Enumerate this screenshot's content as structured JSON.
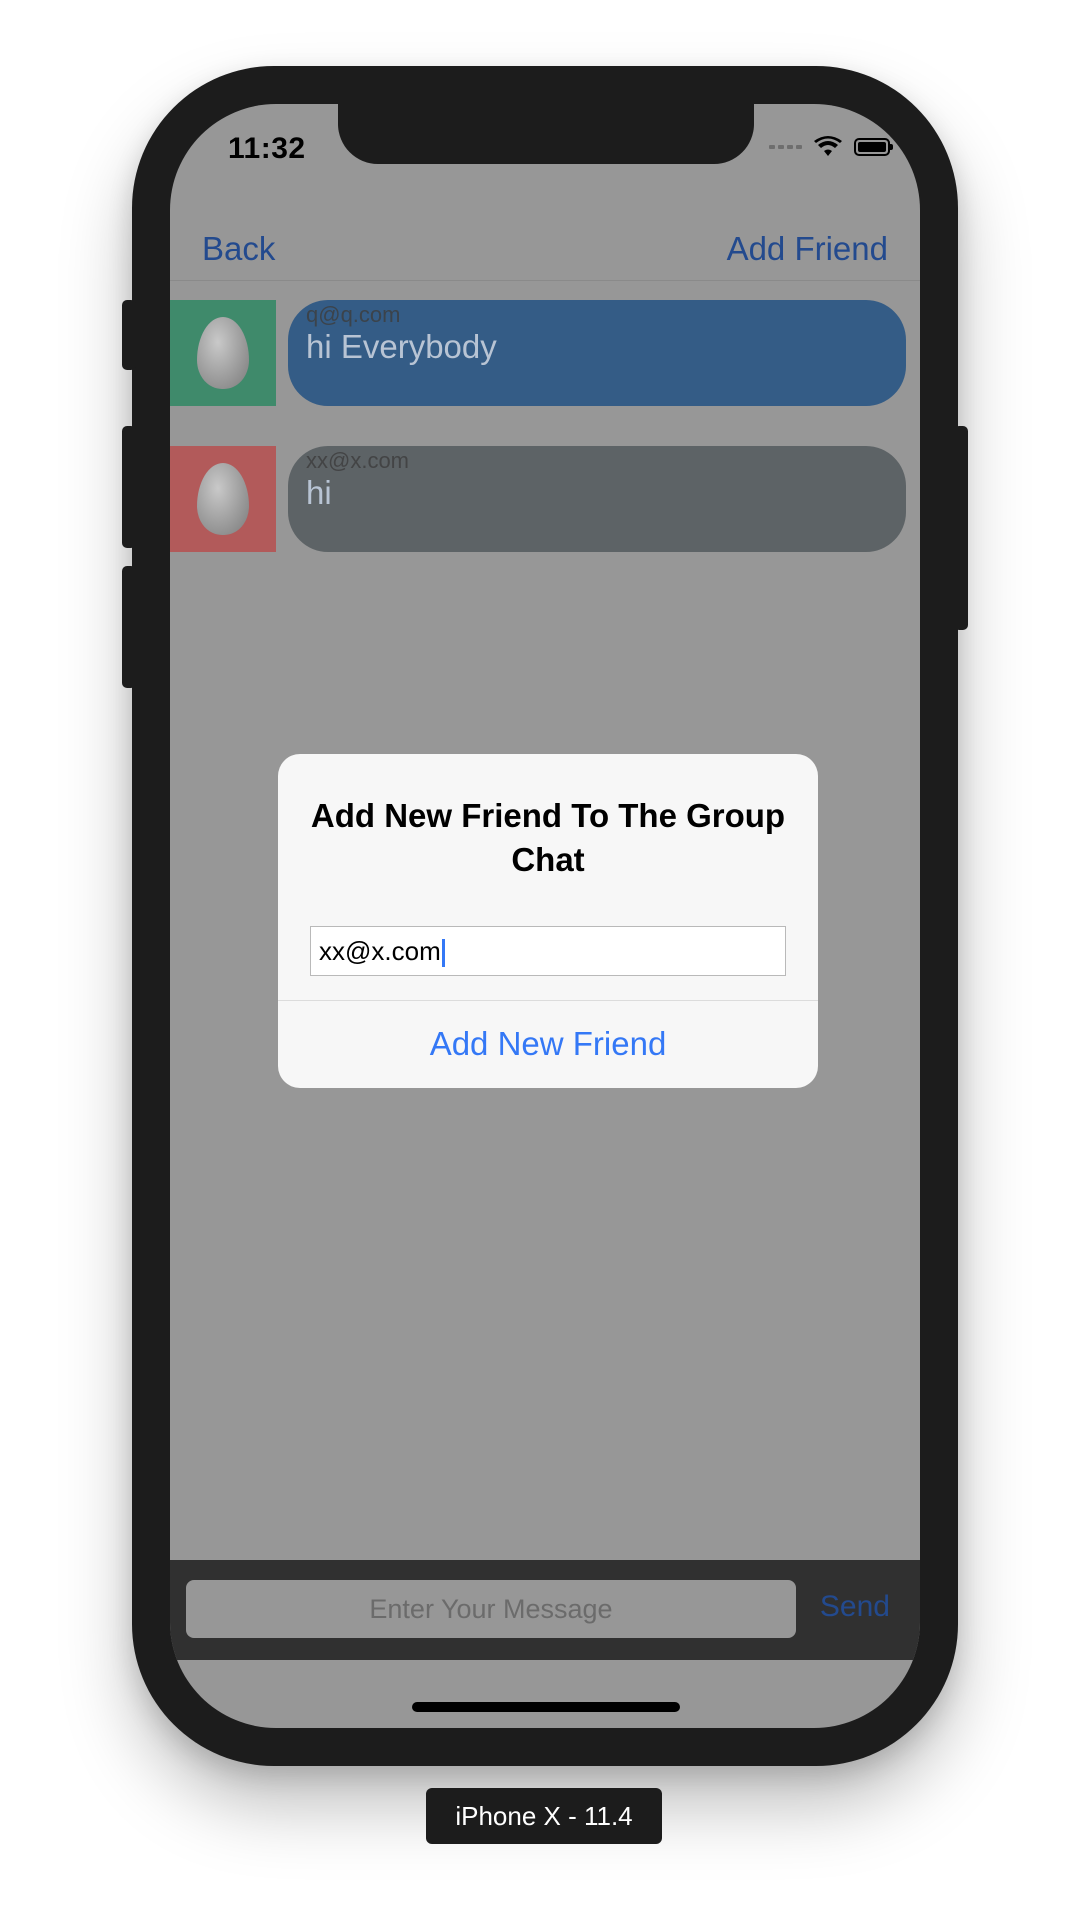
{
  "status_bar": {
    "time": "11:32"
  },
  "nav": {
    "back_label": "Back",
    "add_friend_label": "Add Friend"
  },
  "messages": [
    {
      "sender": "q@q.com",
      "text": "hi Everybody",
      "avatar_color": "#3f8a6b",
      "bubble_color": "#345c86"
    },
    {
      "sender": "xx@x.com",
      "text": "hi",
      "avatar_color": "#b25a5a",
      "bubble_color": "#5d6366"
    }
  ],
  "dialog": {
    "title": "Add New Friend To The Group Chat",
    "field_value": "xx@x.com",
    "action_label": "Add New Friend"
  },
  "composer": {
    "placeholder": "Enter Your Message",
    "send_label": "Send"
  },
  "device_label": "iPhone X - 11.4",
  "colors": {
    "accent": "#3478f6",
    "nav_tint": "#234a8e",
    "dim_overlay": "#979797"
  }
}
